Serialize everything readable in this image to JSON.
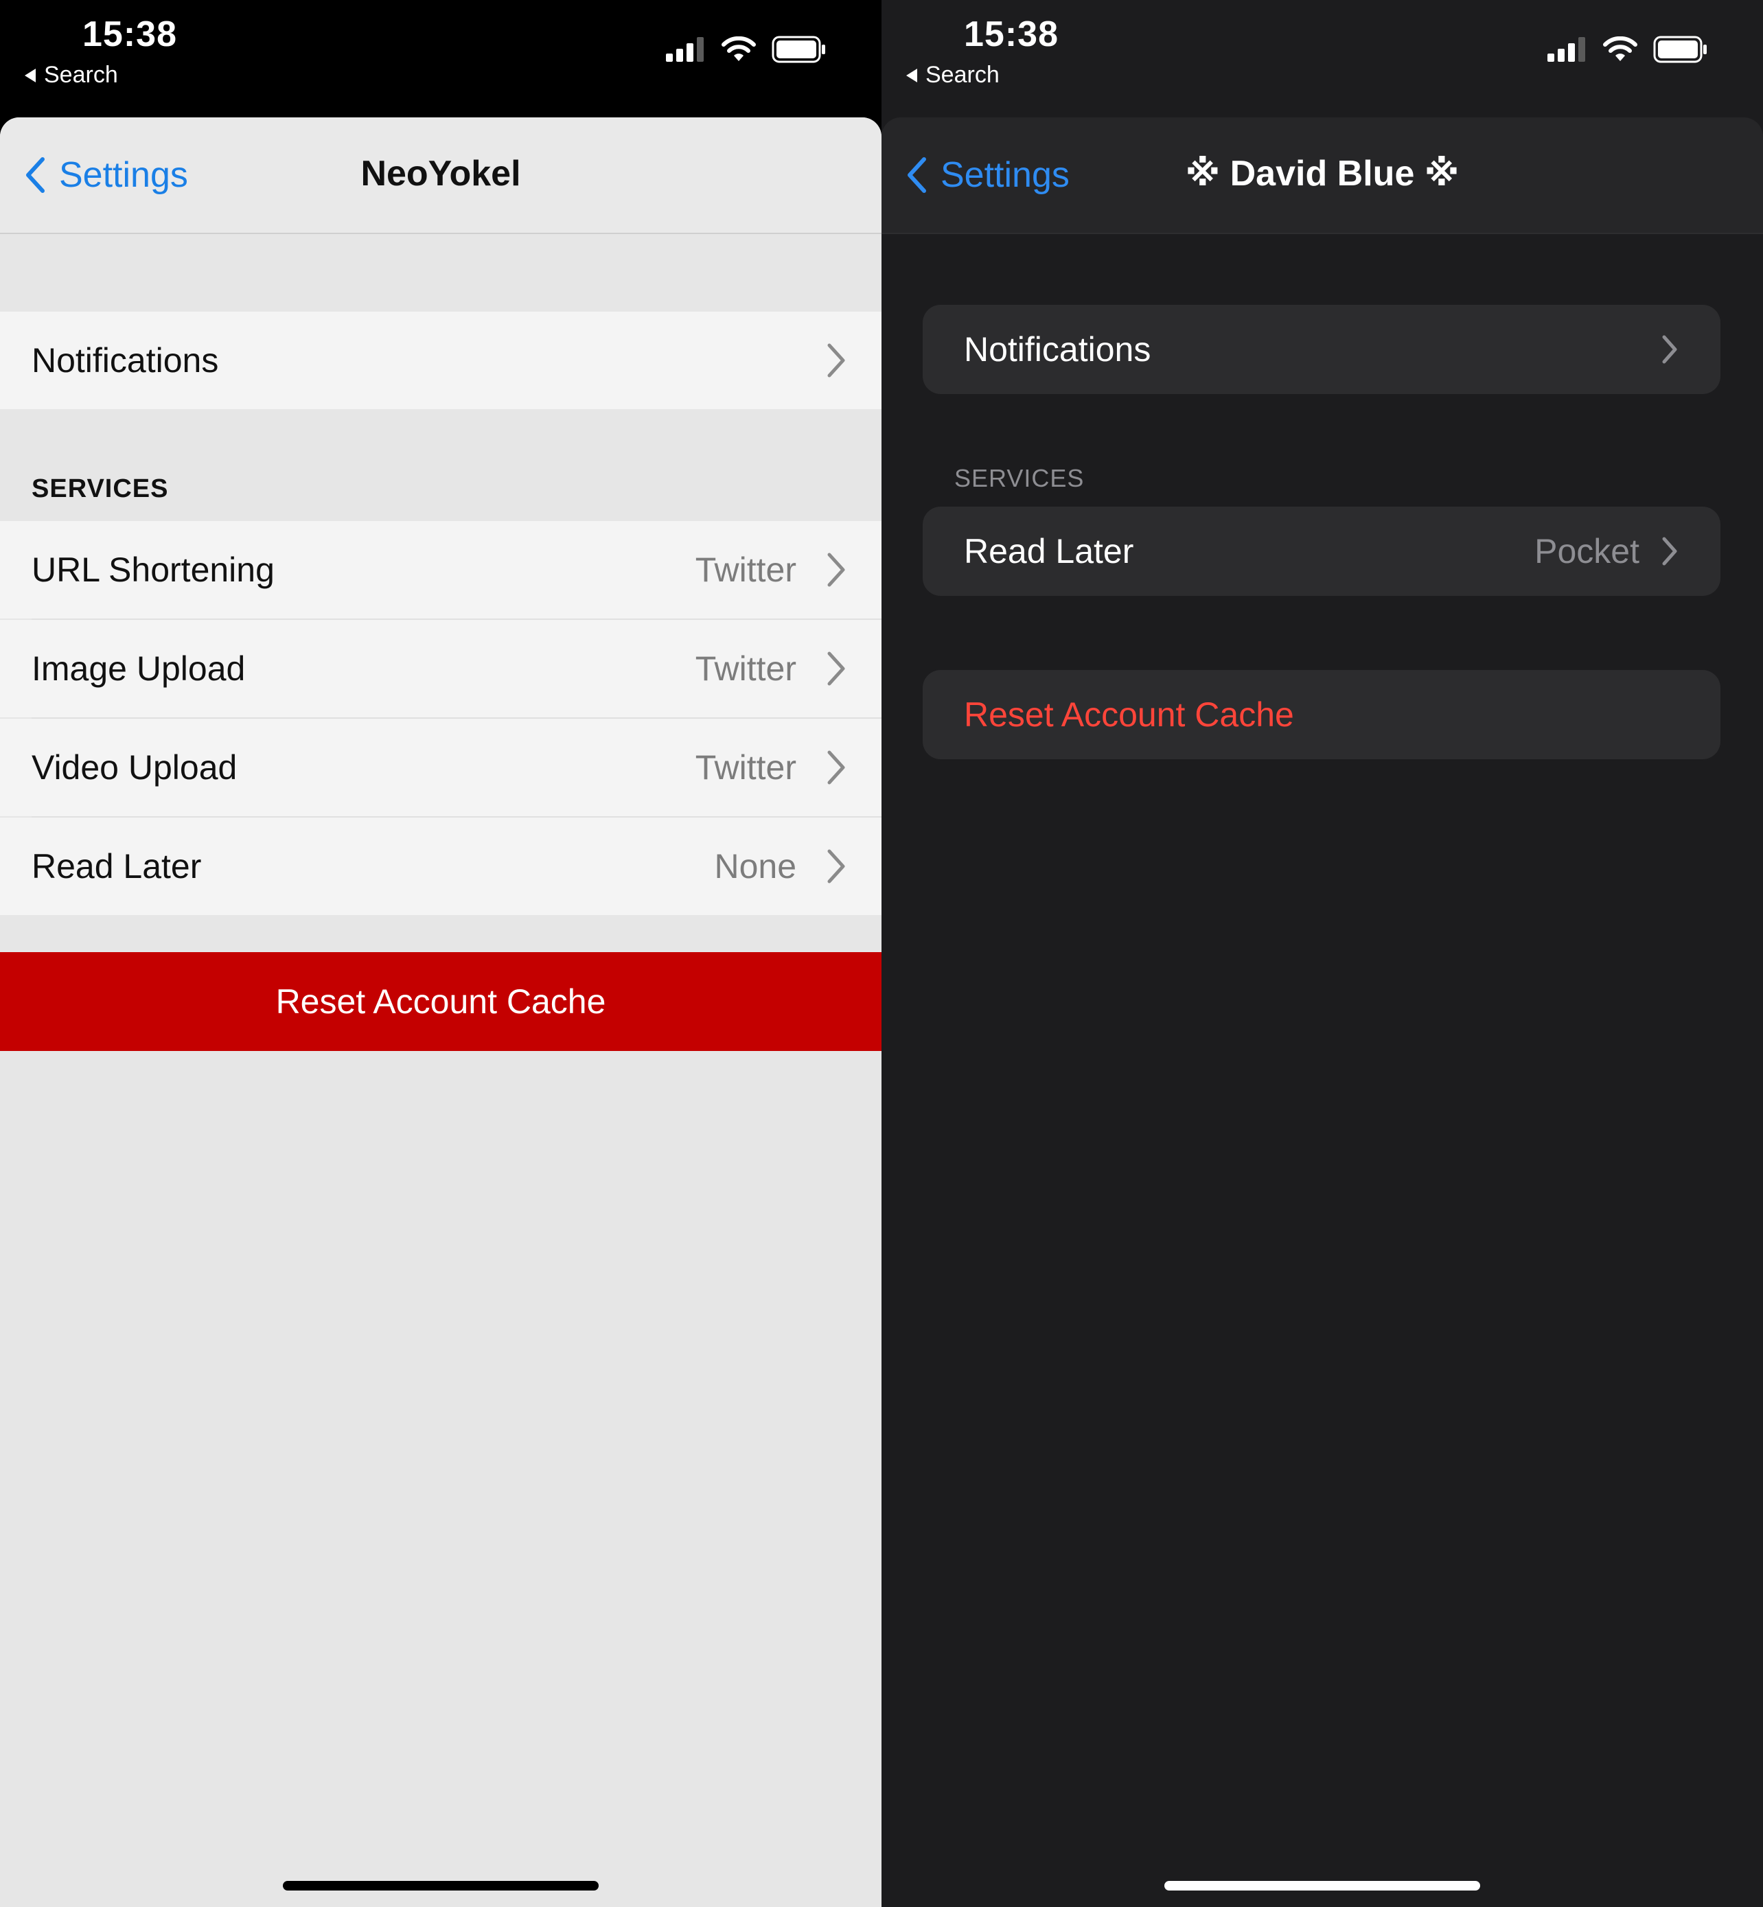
{
  "left": {
    "status": {
      "time": "15:38",
      "back_app": "Search"
    },
    "nav": {
      "back_label": "Settings",
      "title": "NeoYokel"
    },
    "notifications": {
      "label": "Notifications"
    },
    "services": {
      "header": "SERVICES",
      "rows": [
        {
          "label": "URL Shortening",
          "value": "Twitter"
        },
        {
          "label": "Image Upload",
          "value": "Twitter"
        },
        {
          "label": "Video Upload",
          "value": "Twitter"
        },
        {
          "label": "Read Later",
          "value": "None"
        }
      ]
    },
    "reset_label": "Reset Account Cache"
  },
  "right": {
    "status": {
      "time": "15:38",
      "back_app": "Search"
    },
    "nav": {
      "back_label": "Settings",
      "title": "※ David Blue ※"
    },
    "notifications": {
      "label": "Notifications"
    },
    "services": {
      "header": "SERVICES",
      "rows": [
        {
          "label": "Read Later",
          "value": "Pocket"
        }
      ]
    },
    "reset_label": "Reset Account Cache"
  },
  "colors": {
    "accent_light": "#1a7fe6",
    "accent_dark": "#2f8cf2",
    "destructive_light_bg": "#c40000",
    "destructive_dark_text": "#ff453a"
  }
}
